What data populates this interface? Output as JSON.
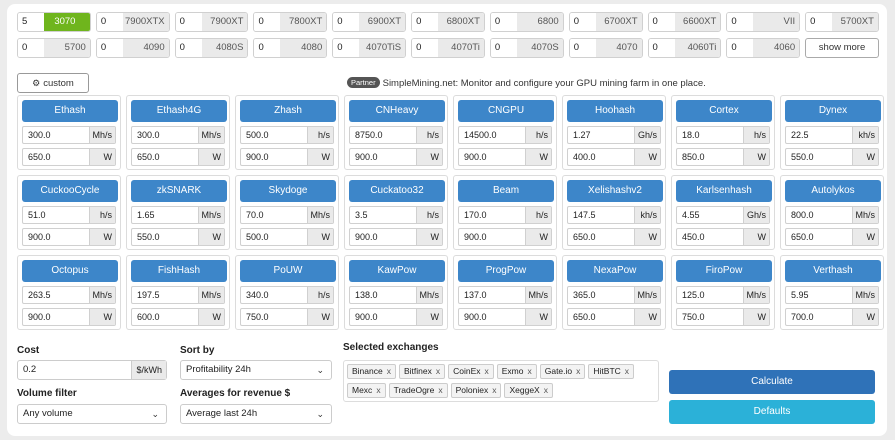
{
  "gpus": [
    [
      {
        "count": "5",
        "name": "3070",
        "selected": true
      },
      {
        "count": "0",
        "name": "7900XTX"
      },
      {
        "count": "0",
        "name": "7900XT"
      },
      {
        "count": "0",
        "name": "7800XT"
      },
      {
        "count": "0",
        "name": "6900XT"
      },
      {
        "count": "0",
        "name": "6800XT"
      },
      {
        "count": "0",
        "name": "6800"
      },
      {
        "count": "0",
        "name": "6700XT"
      },
      {
        "count": "0",
        "name": "6600XT"
      },
      {
        "count": "0",
        "name": "VII"
      },
      {
        "count": "0",
        "name": "5700XT"
      }
    ],
    [
      {
        "count": "0",
        "name": "5700"
      },
      {
        "count": "0",
        "name": "4090"
      },
      {
        "count": "0",
        "name": "4080S"
      },
      {
        "count": "0",
        "name": "4080"
      },
      {
        "count": "0",
        "name": "4070TiS"
      },
      {
        "count": "0",
        "name": "4070Ti"
      },
      {
        "count": "0",
        "name": "4070S"
      },
      {
        "count": "0",
        "name": "4070"
      },
      {
        "count": "0",
        "name": "4060Ti"
      },
      {
        "count": "0",
        "name": "4060"
      }
    ]
  ],
  "show_more": "show more",
  "custom_label": "custom",
  "partner": {
    "badge": "Partner",
    "text": "SimpleMining.net: Monitor and configure your GPU mining farm in one place."
  },
  "algos": [
    {
      "name": "Ethash",
      "hashrate": "300.0",
      "hash_unit": "Mh/s",
      "power": "650.0",
      "power_unit": "W"
    },
    {
      "name": "Ethash4G",
      "hashrate": "300.0",
      "hash_unit": "Mh/s",
      "power": "650.0",
      "power_unit": "W"
    },
    {
      "name": "Zhash",
      "hashrate": "500.0",
      "hash_unit": "h/s",
      "power": "900.0",
      "power_unit": "W"
    },
    {
      "name": "CNHeavy",
      "hashrate": "8750.0",
      "hash_unit": "h/s",
      "power": "900.0",
      "power_unit": "W"
    },
    {
      "name": "CNGPU",
      "hashrate": "14500.0",
      "hash_unit": "h/s",
      "power": "900.0",
      "power_unit": "W"
    },
    {
      "name": "Hoohash",
      "hashrate": "1.27",
      "hash_unit": "Gh/s",
      "power": "400.0",
      "power_unit": "W"
    },
    {
      "name": "Cortex",
      "hashrate": "18.0",
      "hash_unit": "h/s",
      "power": "850.0",
      "power_unit": "W"
    },
    {
      "name": "Dynex",
      "hashrate": "22.5",
      "hash_unit": "kh/s",
      "power": "550.0",
      "power_unit": "W"
    },
    {
      "name": "CuckooCycle",
      "hashrate": "51.0",
      "hash_unit": "h/s",
      "power": "900.0",
      "power_unit": "W"
    },
    {
      "name": "zkSNARK",
      "hashrate": "1.65",
      "hash_unit": "Mh/s",
      "power": "550.0",
      "power_unit": "W"
    },
    {
      "name": "Skydoge",
      "hashrate": "70.0",
      "hash_unit": "Mh/s",
      "power": "500.0",
      "power_unit": "W"
    },
    {
      "name": "Cuckatoo32",
      "hashrate": "3.5",
      "hash_unit": "h/s",
      "power": "900.0",
      "power_unit": "W"
    },
    {
      "name": "Beam",
      "hashrate": "170.0",
      "hash_unit": "h/s",
      "power": "900.0",
      "power_unit": "W"
    },
    {
      "name": "Xelishashv2",
      "hashrate": "147.5",
      "hash_unit": "kh/s",
      "power": "650.0",
      "power_unit": "W"
    },
    {
      "name": "Karlsenhash",
      "hashrate": "4.55",
      "hash_unit": "Gh/s",
      "power": "450.0",
      "power_unit": "W"
    },
    {
      "name": "Autolykos",
      "hashrate": "800.0",
      "hash_unit": "Mh/s",
      "power": "650.0",
      "power_unit": "W"
    },
    {
      "name": "Octopus",
      "hashrate": "263.5",
      "hash_unit": "Mh/s",
      "power": "900.0",
      "power_unit": "W"
    },
    {
      "name": "FishHash",
      "hashrate": "197.5",
      "hash_unit": "Mh/s",
      "power": "600.0",
      "power_unit": "W"
    },
    {
      "name": "PoUW",
      "hashrate": "340.0",
      "hash_unit": "h/s",
      "power": "750.0",
      "power_unit": "W"
    },
    {
      "name": "KawPow",
      "hashrate": "138.0",
      "hash_unit": "Mh/s",
      "power": "900.0",
      "power_unit": "W"
    },
    {
      "name": "ProgPow",
      "hashrate": "137.0",
      "hash_unit": "Mh/s",
      "power": "900.0",
      "power_unit": "W"
    },
    {
      "name": "NexaPow",
      "hashrate": "365.0",
      "hash_unit": "Mh/s",
      "power": "650.0",
      "power_unit": "W"
    },
    {
      "name": "FiroPow",
      "hashrate": "125.0",
      "hash_unit": "Mh/s",
      "power": "750.0",
      "power_unit": "W"
    },
    {
      "name": "Verthash",
      "hashrate": "5.95",
      "hash_unit": "Mh/s",
      "power": "700.0",
      "power_unit": "W"
    }
  ],
  "form": {
    "cost_label": "Cost",
    "cost_value": "0.2",
    "cost_unit": "$/kWh",
    "volume_label": "Volume filter",
    "volume_value": "Any volume",
    "sortby_label": "Sort by",
    "sortby_value": "Profitability 24h",
    "averages_label": "Averages for revenue $",
    "averages_value": "Average last 24h",
    "exchanges_label": "Selected exchanges",
    "exchanges": [
      "Binance",
      "Bitfinex",
      "CoinEx",
      "Exmo",
      "Gate.io",
      "HitBTC",
      "Mexc",
      "TradeOgre",
      "Poloniex",
      "XeggeX"
    ],
    "tag_remove": "x",
    "calculate": "Calculate",
    "defaults": "Defaults"
  },
  "colors": {
    "selected_gpu": "#6fb51d",
    "algo_button": "#3d86c9",
    "calculate": "#2f72b8",
    "defaults": "#2bb1d8"
  },
  "icons": {
    "custom": "gpu-chip-icon",
    "chevron": "chevron-down-icon"
  }
}
